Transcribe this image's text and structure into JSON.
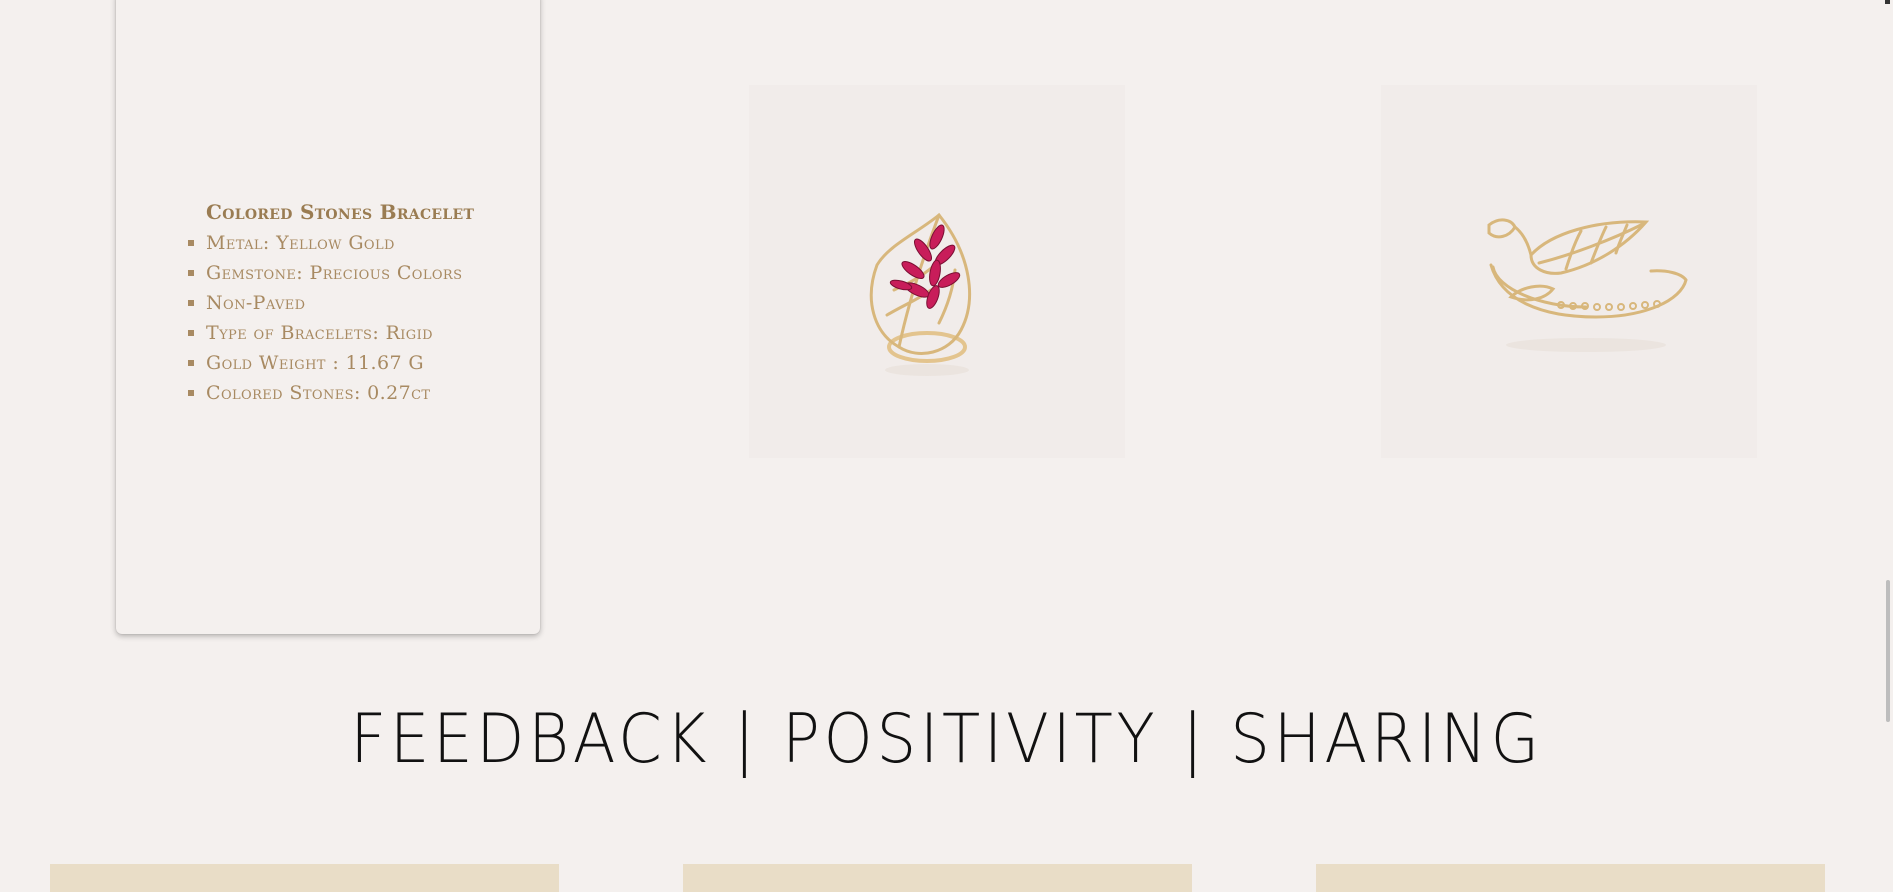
{
  "spec_card": {
    "title": "Colored Stones Bracelet",
    "items": [
      "Metal: Yellow Gold",
      "Gemstone: Precious Colors",
      "Non-Paved",
      "Type of Bracelets: Rigid",
      "Gold Weight : 11.67 G",
      "Colored Stones: 0.27ct"
    ]
  },
  "products": [
    {
      "image": "leaf-ring-with-pink-stones"
    },
    {
      "image": "leaf-bangle-bracelet"
    }
  ],
  "section": {
    "title": "FEEDBACK | POSITIVITY | SHARING"
  },
  "feedback_cards": [
    {
      "color": "#e9ddc7"
    },
    {
      "color": "#e9ddc7"
    },
    {
      "color": "#e9ddc7"
    }
  ],
  "colors": {
    "background": "#f4f0ee",
    "accent_gold": "#a88a62",
    "title_gold": "#9a7c52",
    "card_beige": "#e9ddc7",
    "ruby": "#c81d5a"
  }
}
